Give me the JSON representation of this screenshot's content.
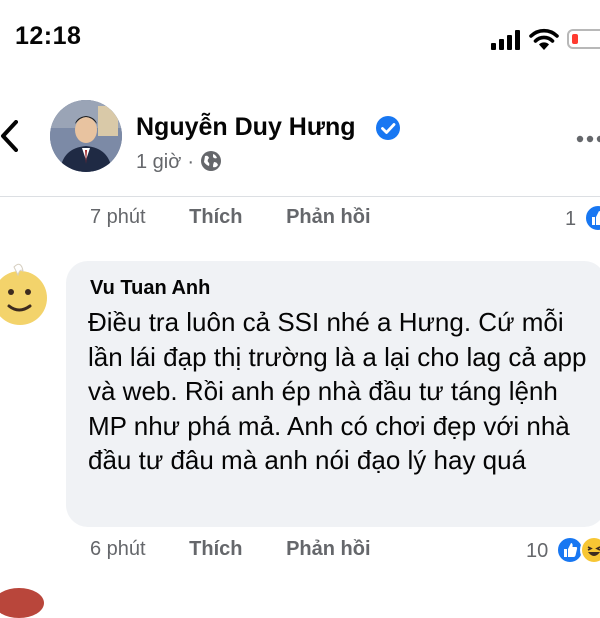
{
  "status_bar": {
    "time": "12:18"
  },
  "post": {
    "author": "Nguyễn Duy Hưng",
    "verified": true,
    "time_ago": "1 giờ",
    "separator": "·",
    "audience_icon": "globe-icon"
  },
  "previous_comment": {
    "time": "7 phút",
    "like_label": "Thích",
    "reply_label": "Phản hồi",
    "reaction_count": "1"
  },
  "comment": {
    "author": "Vu Tuan Anh",
    "text": "Điều tra luôn cả SSI nhé a Hưng. Cứ mỗi lần lái đạp thị trường là a lại cho lag cả app và web. Rồi anh ép nhà đầu tư táng lệnh MP như phá mả. Anh có chơi đẹp với nhà đầu tư đâu mà anh nói đạo lý hay quá",
    "time": "6 phút",
    "like_label": "Thích",
    "reply_label": "Phản hồi",
    "reaction_count": "10",
    "reactions": [
      "like-icon",
      "haha-icon"
    ]
  },
  "colors": {
    "accent": "#1877f2",
    "secondary_text": "#65676b",
    "bubble": "#f0f2f5",
    "battery_low": "#ff3b30"
  }
}
